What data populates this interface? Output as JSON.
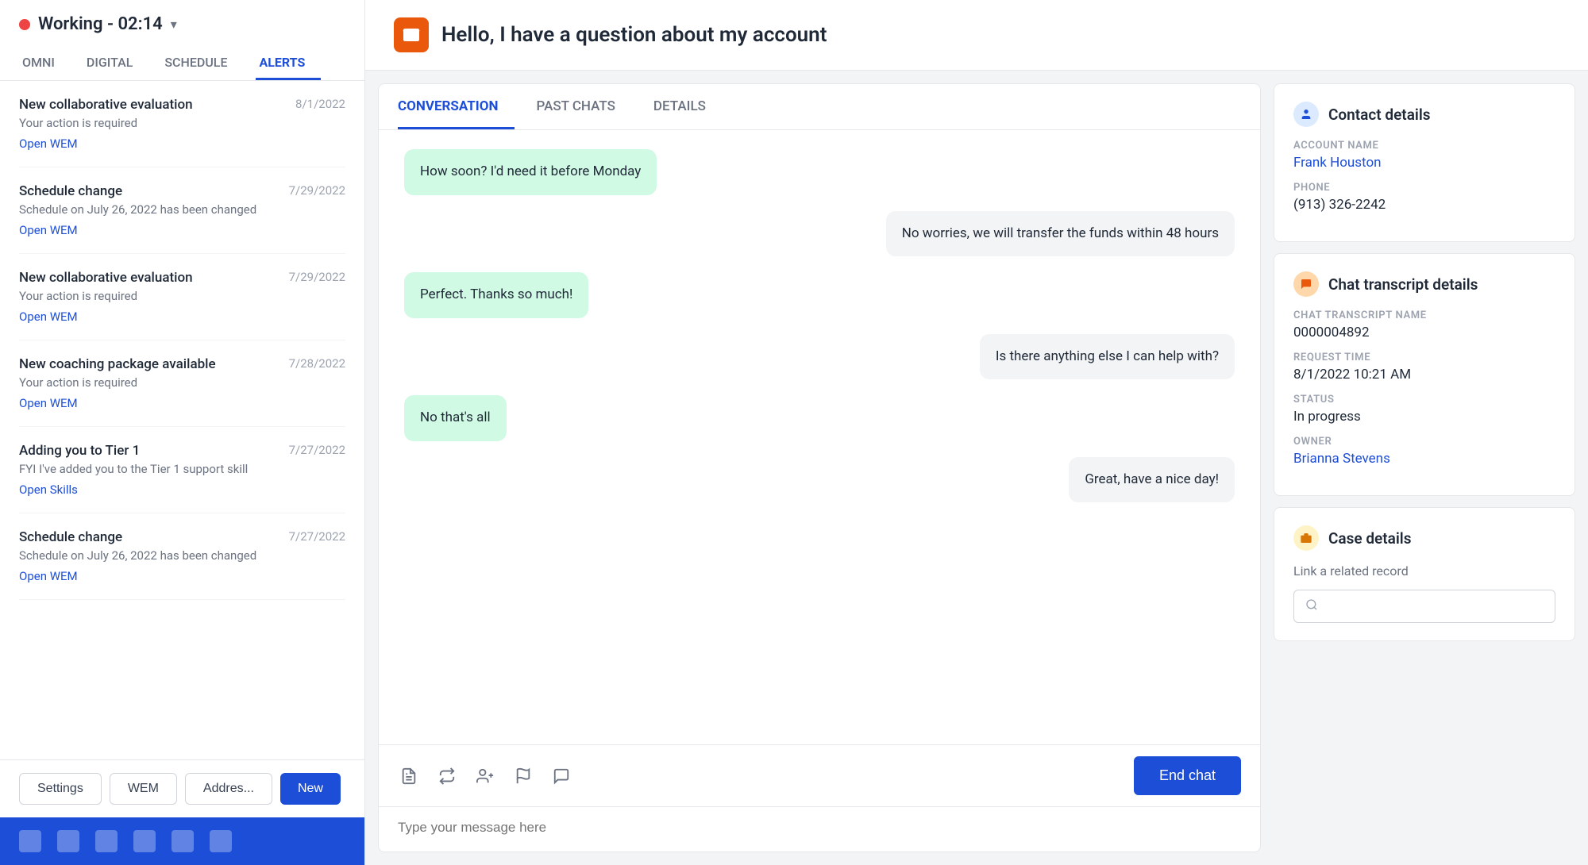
{
  "sidebar": {
    "status": {
      "text": "Working - 02:14",
      "dot_color": "#ef4444"
    },
    "nav_tabs": [
      {
        "id": "omni",
        "label": "OMNI",
        "active": false
      },
      {
        "id": "digital",
        "label": "DIGITAL",
        "active": false
      },
      {
        "id": "schedule",
        "label": "SCHEDULE",
        "active": false
      },
      {
        "id": "alerts",
        "label": "ALERTS",
        "active": true
      }
    ],
    "alerts": [
      {
        "title": "New collaborative evaluation",
        "date": "8/1/2022",
        "desc": "Your action is required",
        "link": "Open WEM"
      },
      {
        "title": "Schedule change",
        "date": "7/29/2022",
        "desc": "Schedule on July 26, 2022 has been changed",
        "link": "Open WEM"
      },
      {
        "title": "New collaborative evaluation",
        "date": "7/29/2022",
        "desc": "Your action is required",
        "link": "Open WEM"
      },
      {
        "title": "New coaching package available",
        "date": "7/28/2022",
        "desc": "Your action is required",
        "link": "Open WEM"
      },
      {
        "title": "Adding you to Tier 1",
        "date": "7/27/2022",
        "desc": "FYI I've added you to the Tier 1 support skill",
        "link": "Open Skills"
      },
      {
        "title": "Schedule change",
        "date": "7/27/2022",
        "desc": "Schedule on July 26, 2022 has been changed",
        "link": "Open WEM"
      }
    ],
    "footer_buttons": [
      {
        "id": "settings",
        "label": "Settings",
        "primary": false
      },
      {
        "id": "wem",
        "label": "WEM",
        "primary": false
      },
      {
        "id": "addres",
        "label": "Addres...",
        "primary": false
      },
      {
        "id": "new",
        "label": "New",
        "primary": true
      }
    ]
  },
  "chat_header": {
    "icon": "💬",
    "title": "Hello, I have a question about my account"
  },
  "conversation": {
    "tabs": [
      {
        "id": "conversation",
        "label": "CONVERSATION",
        "active": true
      },
      {
        "id": "past_chats",
        "label": "PAST CHATS",
        "active": false
      },
      {
        "id": "details",
        "label": "DETAILS",
        "active": false
      }
    ],
    "messages": [
      {
        "id": 1,
        "type": "incoming",
        "text": "How soon? I'd need it before Monday"
      },
      {
        "id": 2,
        "type": "outgoing",
        "text": "No worries, we will transfer the funds within 48 hours"
      },
      {
        "id": 3,
        "type": "incoming",
        "text": "Perfect. Thanks so much!"
      },
      {
        "id": 4,
        "type": "outgoing",
        "text": "Is there anything else I can help with?"
      },
      {
        "id": 5,
        "type": "incoming",
        "text": "No that's all"
      },
      {
        "id": 6,
        "type": "outgoing",
        "text": "Great, have a nice day!"
      }
    ],
    "end_chat_label": "End chat",
    "input_placeholder": "Type your message here"
  },
  "contact_details": {
    "title": "Contact details",
    "account_name_label": "ACCOUNT NAME",
    "account_name": "Frank Houston",
    "phone_label": "PHONE",
    "phone": "(913) 326-2242"
  },
  "chat_transcript": {
    "title": "Chat transcript details",
    "transcript_name_label": "CHAT TRANSCRIPT NAME",
    "transcript_name": "0000004892",
    "request_time_label": "REQUEST TIME",
    "request_time": "8/1/2022 10:21 AM",
    "status_label": "STATUS",
    "status": "In progress",
    "owner_label": "OWNER",
    "owner": "Brianna Stevens"
  },
  "case_details": {
    "title": "Case details",
    "link_label": "Link a related record",
    "search_placeholder": ""
  },
  "icons": {
    "chevron": "▾",
    "person": "👤",
    "chat": "💬",
    "case": "📋",
    "search": "🔍",
    "transfer": "⇄",
    "add_person": "👤+",
    "flag": "⚑",
    "comment": "💬",
    "note": "📝"
  }
}
